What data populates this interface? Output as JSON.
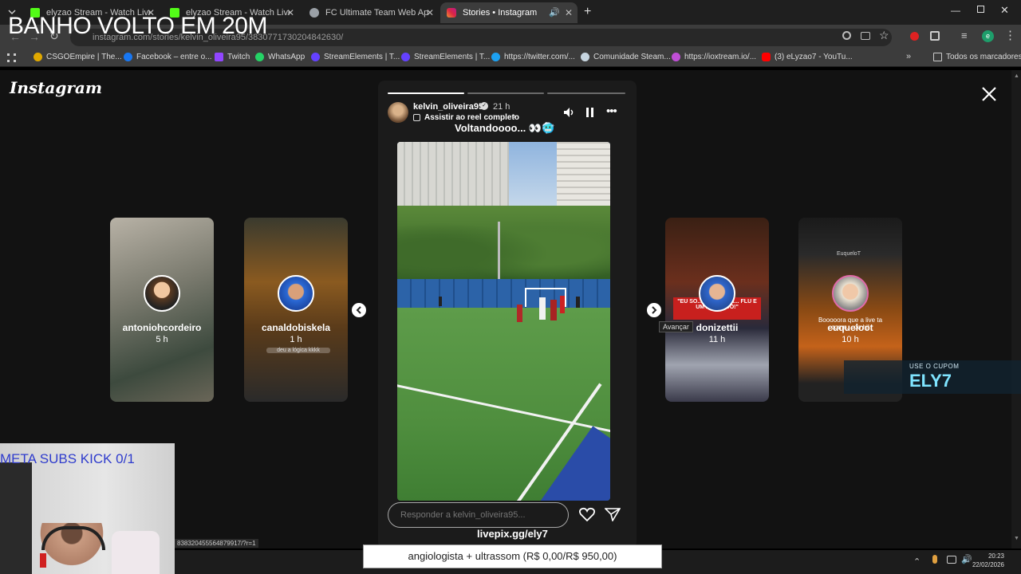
{
  "tabs": [
    {
      "title": "elyzao Stream - Watch Live on",
      "icon": "kick-icon",
      "color": "#53fc18",
      "active": false
    },
    {
      "title": "elyzao Stream - Watch Live on",
      "icon": "kick-icon",
      "color": "#53fc18",
      "active": false
    },
    {
      "title": "FC Ultimate Team Web App - E",
      "icon": "globe-icon",
      "color": "#9aa0a6",
      "active": false
    },
    {
      "title": "Stories • Instagram",
      "icon": "instagram-icon",
      "color": "#d6249f",
      "active": true
    }
  ],
  "address": {
    "url": "instagram.com/stories/kelvin_oliveira95/3830771730204842630/"
  },
  "bookmarks": [
    {
      "label": "CSGOEmpire | The...",
      "color": "#e0a800"
    },
    {
      "label": "Facebook – entre o...",
      "color": "#1877f2"
    },
    {
      "label": "Twitch",
      "color": "#9146ff"
    },
    {
      "label": "WhatsApp",
      "color": "#25d366"
    },
    {
      "label": "StreamElements | T...",
      "color": "#6441ff"
    },
    {
      "label": "StreamElements | T...",
      "color": "#6441ff"
    },
    {
      "label": "https://twitter.com/...",
      "color": "#1da1f2"
    },
    {
      "label": "Comunidade Steam...",
      "color": "#c7d5e0"
    },
    {
      "label": "https://ioxtream.io/...",
      "color": "#c04fd6"
    },
    {
      "label": "(3) eLyzao7 - YouTu...",
      "color": "#ff0000"
    }
  ],
  "bookmarks_all": "Todos os marcadores",
  "instagram": {
    "logo": "Instagram",
    "previews": [
      {
        "username": "antoniohcordeiro",
        "time": "5 h"
      },
      {
        "username": "canaldobiskela",
        "time": "1 h",
        "caption": "deu a lógica kkkk"
      },
      {
        "username": "donizettii",
        "time": "11 h",
        "caption": "\"EU SO... MAS A TOR... FLU E UM ABSURDO!\""
      },
      {
        "username": "euqueloot",
        "time": "10 h",
        "caption": "Booooora que a live ta come... do hj!",
        "brand": "EuqueloT"
      }
    ],
    "story": {
      "username": "kelvin_oliveira95",
      "time": "21 h",
      "reel_link": "Assistir ao reel completo",
      "caption": "Voltandoooo... 👀🥶",
      "reply_placeholder": "Responder a kelvin_oliveira95..."
    },
    "tooltip": "Avançar"
  },
  "overlays": {
    "top_text": "BANHO VOLTO EM 20M",
    "meta_subs": "META SUBS KICK 0/1",
    "coupon_label": "USE O CUPOM",
    "coupon_code": "ELY7",
    "livepix": "livepix.gg/ely7",
    "pix_goal": "angiologista + ultrassom (R$ 0,00/R$ 950,00)",
    "status_url": "838320455564879917/?r=1"
  },
  "taskbar": {
    "time": "20:23",
    "date": "22/02/2026"
  }
}
